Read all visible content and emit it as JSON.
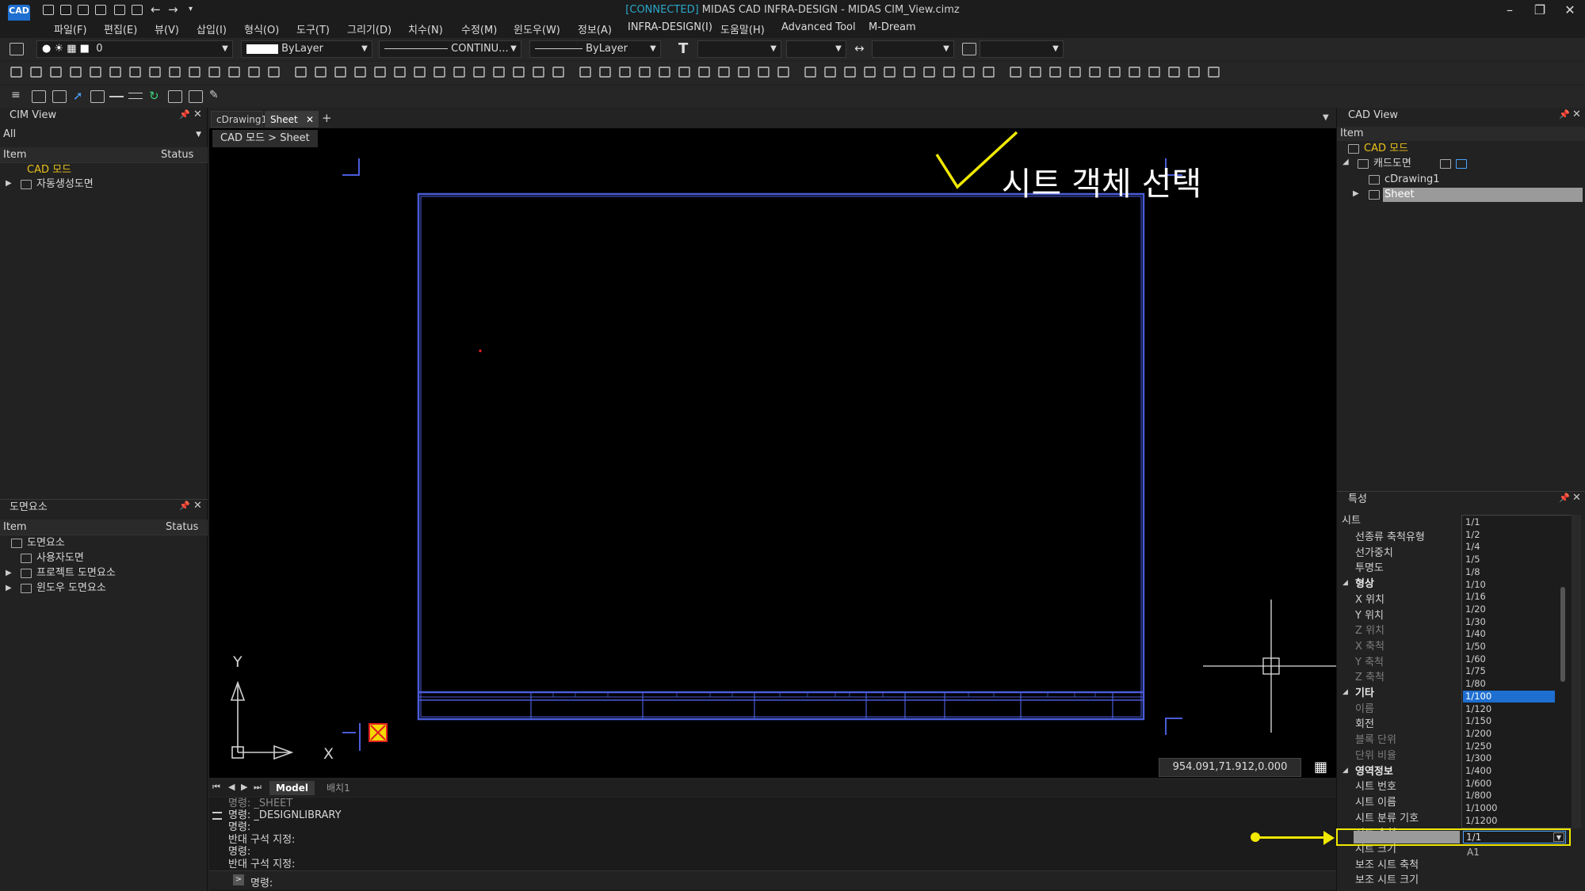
{
  "window": {
    "connected_tag": "[CONNECTED]",
    "title": "MIDAS CAD INFRA-DESIGN - MIDAS CIM_View.cimz",
    "logo_text": "CAD"
  },
  "menu": [
    "파일(F)",
    "편집(E)",
    "뷰(V)",
    "삽입(I)",
    "형식(O)",
    "도구(T)",
    "그리기(D)",
    "치수(N)",
    "수정(M)",
    "윈도우(W)",
    "정보(A)",
    "INFRA-DESIGN(I)",
    "도움말(H)",
    "Advanced Tool",
    "M-Dream"
  ],
  "toolbar": {
    "layer_value": "0",
    "color_value": "ByLayer",
    "linetype_value": "CONTINU...",
    "lineweight_value": "ByLayer"
  },
  "cim_view": {
    "title": "CIM View",
    "filter": "All",
    "col_item": "Item",
    "col_status": "Status",
    "items": [
      "CAD 모드",
      "자동생성도면"
    ]
  },
  "drawing_elements": {
    "title": "도면요소",
    "col_item": "Item",
    "col_status": "Status",
    "items": [
      "도면요소",
      "사용자도면",
      "프로젝트 도면요소",
      "윈도우 도면요소"
    ]
  },
  "doc_tabs": [
    "cDrawing1",
    "Sheet"
  ],
  "breadcrumb": "CAD 모드 > Sheet",
  "annotation": {
    "callout_text": "시트 객체 선택",
    "highlight_color": "#f0e800"
  },
  "canvas": {
    "coordinates": "954.091,71.912,0.000",
    "axis_x": "X",
    "axis_y": "Y",
    "model_tab": "Model",
    "layout_tab": "배치1",
    "frame_color": "#4a5cd8"
  },
  "command": {
    "lines": [
      "명령: _SHEET",
      "명령: _DESIGNLIBRARY",
      "명령:",
      "반대 구석 지정:",
      "명령:",
      "반대 구석 지정:"
    ],
    "prompt": "명령:"
  },
  "cad_view": {
    "title": "CAD View",
    "col_item": "Item",
    "items": [
      "CAD 모드",
      "캐드도면",
      "cDrawing1",
      "Sheet"
    ]
  },
  "properties": {
    "title": "특성",
    "object_type": "시트",
    "rows": [
      {
        "label": "선종류 축척유형",
        "kind": "normal"
      },
      {
        "label": "선가중치",
        "kind": "normal"
      },
      {
        "label": "투명도",
        "kind": "normal"
      },
      {
        "label": "형상",
        "kind": "group"
      },
      {
        "label": "X 위치",
        "kind": "normal"
      },
      {
        "label": "Y 위치",
        "kind": "normal"
      },
      {
        "label": "Z 위치",
        "kind": "dim"
      },
      {
        "label": "X 축척",
        "kind": "dim"
      },
      {
        "label": "Y 축척",
        "kind": "dim"
      },
      {
        "label": "Z 축척",
        "kind": "dim"
      },
      {
        "label": "기타",
        "kind": "group"
      },
      {
        "label": "이름",
        "kind": "dim"
      },
      {
        "label": "회전",
        "kind": "normal"
      },
      {
        "label": "블록 단위",
        "kind": "dim"
      },
      {
        "label": "단위 비율",
        "kind": "dim"
      },
      {
        "label": "영역정보",
        "kind": "group"
      },
      {
        "label": "시트 번호",
        "kind": "normal"
      },
      {
        "label": "시트 이름",
        "kind": "normal"
      },
      {
        "label": "시트 분류 기호",
        "kind": "normal"
      },
      {
        "label": "시트 축척",
        "kind": "normal"
      },
      {
        "label": "시트 크기",
        "kind": "normal"
      },
      {
        "label": "보조 시트 축척",
        "kind": "normal"
      },
      {
        "label": "보조 시트 크기",
        "kind": "normal"
      }
    ],
    "sheet_scale_value": "1/1",
    "sheet_size_value": "A1",
    "scale_options": [
      "1/1",
      "1/2",
      "1/4",
      "1/5",
      "1/8",
      "1/10",
      "1/16",
      "1/20",
      "1/30",
      "1/40",
      "1/50",
      "1/60",
      "1/75",
      "1/80",
      "1/100",
      "1/120",
      "1/150",
      "1/200",
      "1/250",
      "1/300",
      "1/400",
      "1/600",
      "1/800",
      "1/1000",
      "1/1200"
    ],
    "selected_option": "1/100"
  }
}
